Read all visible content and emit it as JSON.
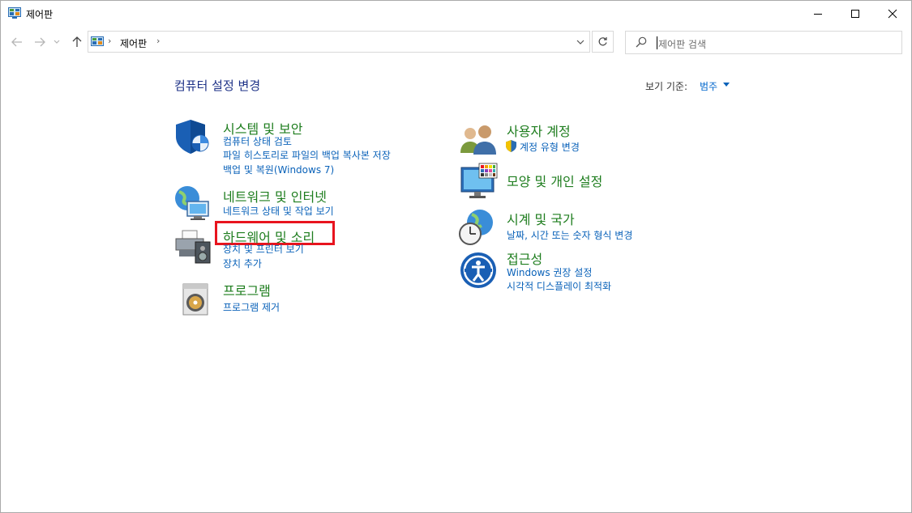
{
  "window": {
    "title": "제어판",
    "icon": "control-panel-icon",
    "buttons": {
      "minimize": "minimize-icon",
      "maximize": "maximize-icon",
      "close": "close-icon"
    }
  },
  "nav": {
    "back_icon": "back-arrow-icon",
    "forward_icon": "forward-arrow-icon",
    "up_icon": "up-arrow-icon",
    "address": {
      "crumb": "제어판",
      "separator": "›"
    },
    "refresh_icon": "refresh-icon",
    "search": {
      "placeholder": "제어판 검색",
      "icon": "search-icon"
    }
  },
  "header": {
    "title": "컴퓨터 설정 변경",
    "view_by_label": "보기 기준:",
    "view_by_value": "범주"
  },
  "categories_left": [
    {
      "title": "시스템 및 보안",
      "icon": "shield-icon",
      "links": [
        "컴퓨터 상태 검토",
        "파일 히스토리로 파일의 백업 복사본 저장",
        "백업 및 복원(Windows 7)"
      ]
    },
    {
      "title": "네트워크 및 인터넷",
      "icon": "network-globe-icon",
      "links": [
        "네트워크 상태 및 작업 보기"
      ]
    },
    {
      "title": "하드웨어 및 소리",
      "icon": "printer-speaker-icon",
      "links": [
        "장치 및 프린터 보기",
        "장치 추가"
      ]
    },
    {
      "title": "프로그램",
      "icon": "program-disc-icon",
      "links": [
        "프로그램 제거"
      ]
    }
  ],
  "categories_right": [
    {
      "title": "사용자 계정",
      "icon": "users-icon",
      "links": [
        "계정 유형 변경"
      ]
    },
    {
      "title": "모양 및 개인 설정",
      "icon": "monitor-palette-icon",
      "links": []
    },
    {
      "title": "시계 및 국가",
      "icon": "clock-globe-icon",
      "links": [
        "날짜, 시간 또는 숫자 형식 변경"
      ]
    },
    {
      "title": "접근성",
      "icon": "accessibility-icon",
      "links": [
        "Windows 권장 설정",
        "시각적 디스플레이 최적화"
      ]
    }
  ],
  "colors": {
    "category_title": "#1e7d1e",
    "link": "#0a62b9",
    "heading": "#1e3287",
    "highlight_box": "#e8141e"
  }
}
